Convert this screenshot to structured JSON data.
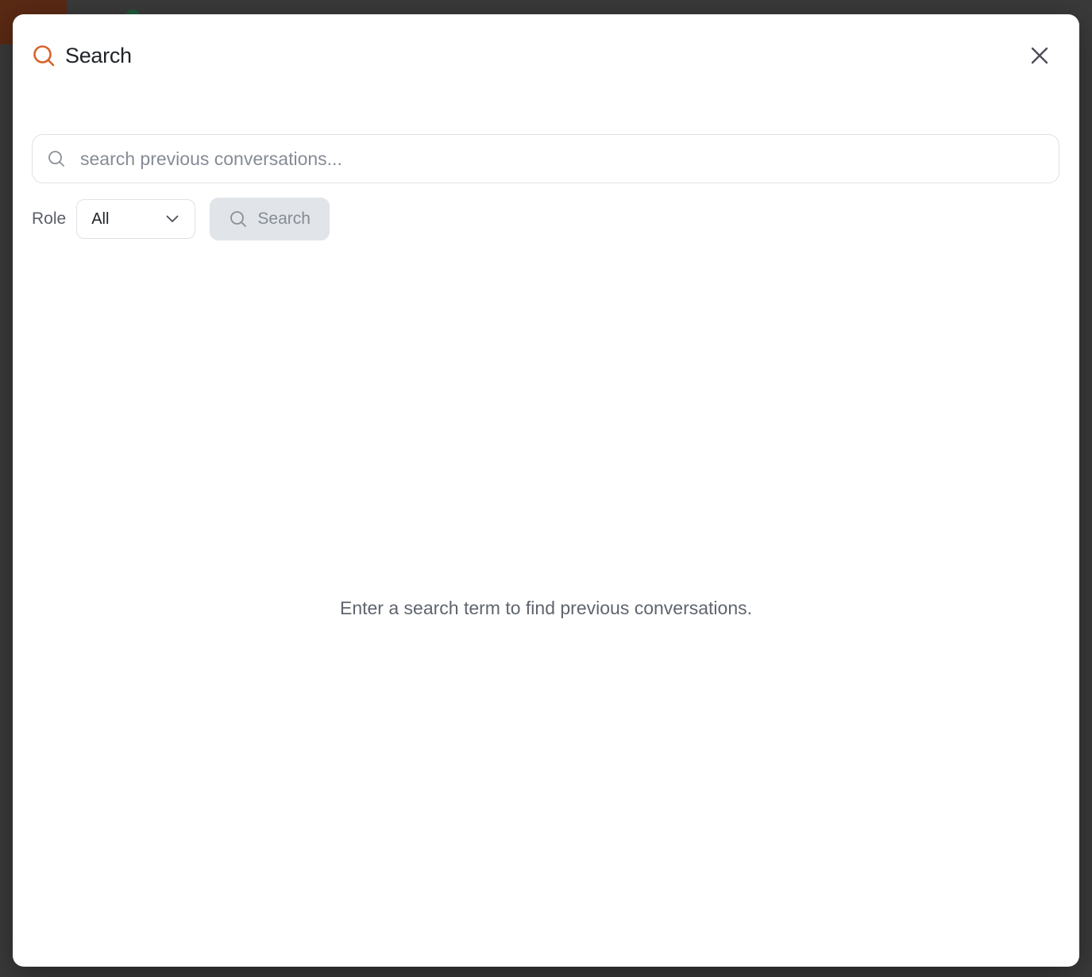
{
  "modal": {
    "title": "Search",
    "icon": "search-icon",
    "close_icon": "close-icon"
  },
  "search": {
    "placeholder": "search previous conversations...",
    "value": ""
  },
  "filters": {
    "role_label": "Role",
    "role_selected": "All",
    "search_button_label": "Search"
  },
  "empty_state": {
    "message": "Enter a search term to find previous conversations."
  },
  "colors": {
    "accent": "#d9622b",
    "backdrop": "#3a3a3a",
    "button_disabled_bg": "#e1e4e8"
  }
}
